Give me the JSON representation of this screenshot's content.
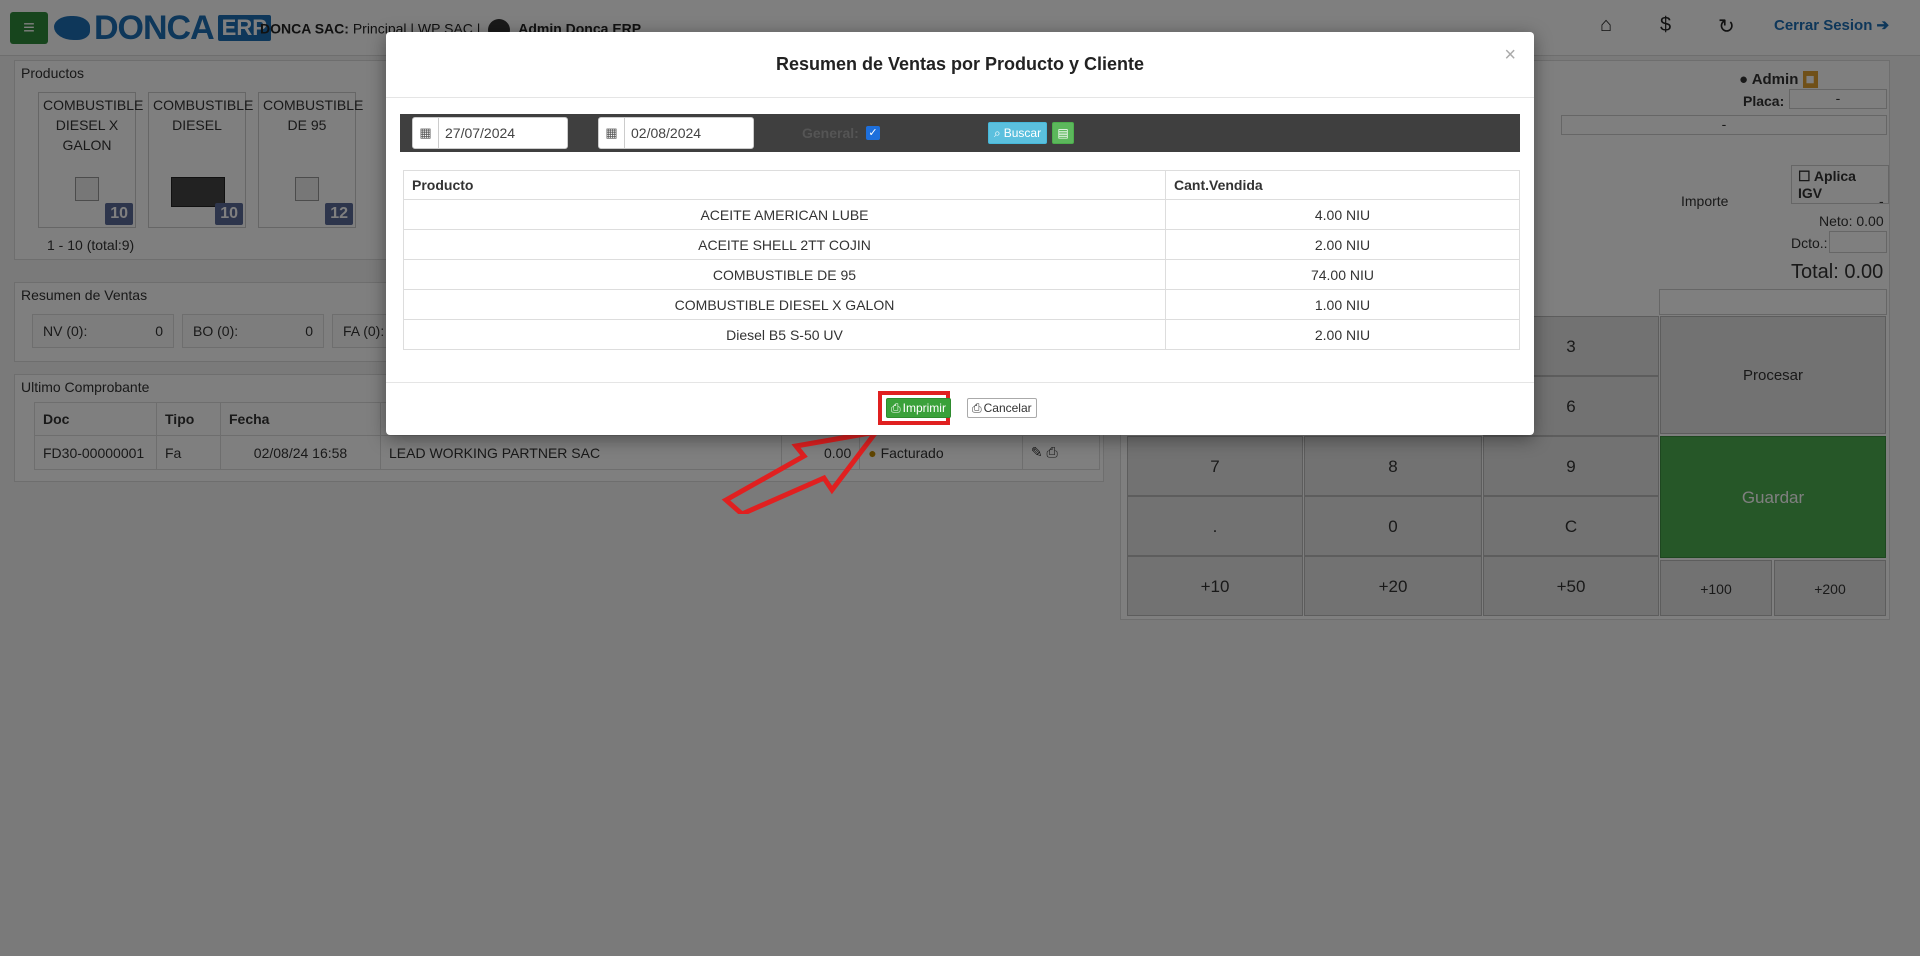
{
  "app": {
    "logo_name": "DONCA",
    "logo_suffix": "ERP",
    "company_label": "DONCA SAC:",
    "company_branch": "Principal | WP SAC |",
    "user_name": "Admin Donca ERP",
    "logout_label": "Cerrar Sesion",
    "admin_label": "Admin"
  },
  "products_panel": {
    "title": "Productos",
    "cards": [
      {
        "name": "COMBUSTIBLE DIESEL X GALON",
        "badge": "10"
      },
      {
        "name": "COMBUSTIBLE DIESEL",
        "badge": "10"
      },
      {
        "name": "COMBUSTIBLE DE 95",
        "badge": "12"
      }
    ],
    "pager": "1 - 10 (total:9)"
  },
  "sales_summary": {
    "title": "Resumen de Ventas",
    "boxes": [
      {
        "label": "NV (0):",
        "value": "0"
      },
      {
        "label": "BO (0):",
        "value": "0"
      },
      {
        "label": "FA (0):",
        "value": ""
      }
    ]
  },
  "last_receipt": {
    "title": "Ultimo Comprobante",
    "headers": [
      "Doc",
      "Tipo",
      "Fecha"
    ],
    "row": {
      "doc": "FD30-00000001",
      "tipo": "Fa",
      "fecha": "02/08/24 16:58",
      "cliente": "LEAD WORKING PARTNER SAC",
      "total": "0.00",
      "estado": "Facturado"
    }
  },
  "right_panel": {
    "placa_label": "Placa:",
    "placa_value": "-",
    "dash": "-",
    "igv_label": "Aplica IGV",
    "importe_label": "Importe",
    "importe_value": "-",
    "neto": "Neto: 0.00",
    "dcto_label": "Dcto.:",
    "total": "Total: 0.00",
    "keys": {
      "k3": "3",
      "k6": "6",
      "k7": "7",
      "k8": "8",
      "k9": "9",
      "kdot": ".",
      "k0": "0",
      "kc": "C",
      "p10": "+10",
      "p20": "+20",
      "p50": "+50",
      "p100": "+100",
      "p200": "+200",
      "procesar": "Procesar",
      "guardar": "Guardar"
    }
  },
  "modal": {
    "title": "Resumen de Ventas por Producto y Cliente",
    "close": "×",
    "date_from": "27/07/2024",
    "date_to": "02/08/2024",
    "general_label": "General:",
    "buscar_label": "Buscar",
    "columns": {
      "producto": "Producto",
      "cantidad": "Cant.Vendida"
    },
    "rows": [
      {
        "producto": "ACEITE AMERICAN LUBE",
        "cantidad": "4.00 NIU"
      },
      {
        "producto": "ACEITE SHELL 2TT COJIN",
        "cantidad": "2.00 NIU"
      },
      {
        "producto": "COMBUSTIBLE DE 95",
        "cantidad": "74.00 NIU"
      },
      {
        "producto": "COMBUSTIBLE DIESEL X GALON",
        "cantidad": "1.00 NIU"
      },
      {
        "producto": "Diesel B5 S-50 UV",
        "cantidad": "2.00 NIU"
      }
    ],
    "imprimir_label": "Imprimir",
    "cancelar_label": "Cancelar"
  },
  "colors": {
    "accent_blue": "#1d6fb5",
    "highlight_red": "#e02020",
    "print_green": "#3aa13a"
  }
}
